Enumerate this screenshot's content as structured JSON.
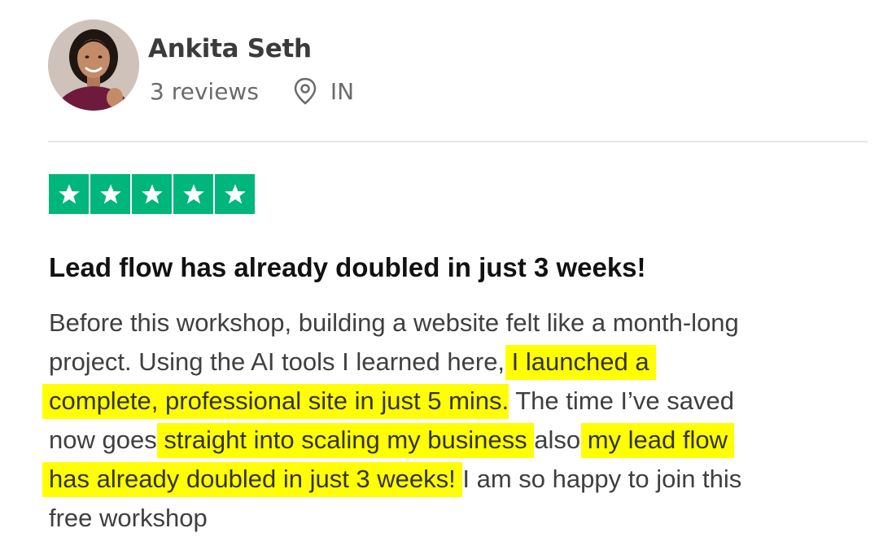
{
  "reviewer": {
    "name": "Ankita Seth",
    "reviews": "3 reviews",
    "country": "IN",
    "location_icon": "location-pin-icon"
  },
  "rating": {
    "stars": 5,
    "max": 5,
    "color": "#00b67a"
  },
  "review": {
    "title": "Lead flow has already doubled in just 3 weeks!",
    "lines": [
      {
        "t1": "Before this workshop, building a website felt like a month-long"
      },
      {
        "t1": "project. Using the AI tools I learned here,",
        "h1": "I launched a"
      },
      {
        "h1": "complete, professional site in just 5 mins",
        "t1": ". The time I’ve saved"
      },
      {
        "t1": "now goes",
        "h1": "straight into scaling my business",
        "t2": "also",
        "h2": "my lead flow"
      },
      {
        "h1": "has already doubled in just 3 weeks!",
        "t1": "I am so happy to join this"
      },
      {
        "t1": "free workshop"
      }
    ],
    "highlight_color": "#ffff00"
  }
}
